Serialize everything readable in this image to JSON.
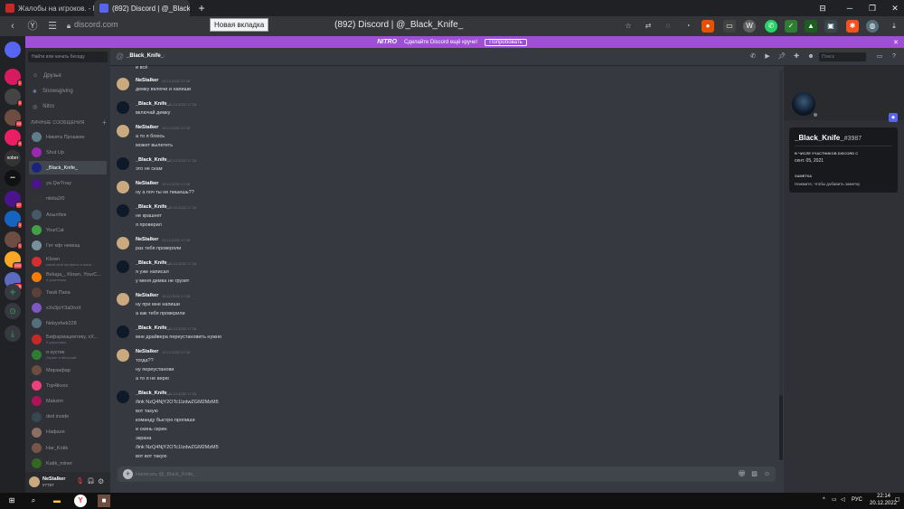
{
  "browser": {
    "tabs": [
      {
        "title": "Жалобы на игроков. - Rc",
        "active": false
      },
      {
        "title": "(892) Discord | @_Black_",
        "active": true
      }
    ],
    "tooltip": "Новая вкладка",
    "url": "discord.com",
    "page_title": "(892) Discord | @_Black_Knife_"
  },
  "nitro_banner": {
    "logo": "NITRO",
    "text": "Сделайте Discord ещё круче!",
    "button": "Попробовать"
  },
  "servers": [
    {
      "initials": "",
      "badge": "",
      "color": "#5865f2"
    },
    {
      "initials": "",
      "badge": "1",
      "color": "#d81b60"
    },
    {
      "initials": "",
      "badge": "3",
      "color": "#444"
    },
    {
      "initials": "",
      "badge": "43",
      "color": "#6d4c41"
    },
    {
      "initials": "",
      "badge": "4",
      "color": "#e91e63"
    },
    {
      "initials": "sober",
      "badge": "",
      "color": "#333"
    },
    {
      "initials": "•••",
      "badge": "",
      "color": "#111"
    },
    {
      "initials": "",
      "badge": "57",
      "color": "#4a148c"
    },
    {
      "initials": "",
      "badge": "3",
      "color": "#1565c0"
    },
    {
      "initials": "",
      "badge": "1",
      "color": "#6d4c41"
    },
    {
      "initials": "",
      "badge": "150",
      "color": "#f9a825"
    },
    {
      "initials": "",
      "badge": "248",
      "color": "#5c6bc0"
    }
  ],
  "sidebar": {
    "search_placeholder": "Найти или начать беседу",
    "nav": [
      {
        "label": "Друзья"
      },
      {
        "label": "Snowsgiving"
      },
      {
        "label": "Nitro"
      }
    ],
    "dm_header": "ЛИЧНЫЕ СООБЩЕНИЯ",
    "dms": [
      {
        "name": "Никита Прошкин",
        "sub": "",
        "color": "#607d8b"
      },
      {
        "name": "Shut Up",
        "sub": "",
        "color": "#9c27b0"
      },
      {
        "name": "_Black_Knife_",
        "sub": "",
        "color": "#1a237e",
        "selected": true
      },
      {
        "name": "ya QwTnay",
        "sub": "",
        "color": "#4a148c"
      },
      {
        "name": "nikita2/0",
        "sub": "",
        "color": "#333"
      },
      {
        "name": "Асылбек",
        "sub": "",
        "color": "#455a64"
      },
      {
        "name": "YourCat",
        "sub": "",
        "color": "#43a047"
      },
      {
        "name": "Гет кфг немощ",
        "sub": "",
        "color": "#78909c"
      },
      {
        "name": "Klown",
        "sub": "какой-мой профиль и напи...",
        "color": "#d32f2f"
      },
      {
        "name": "Beluga_, Klown, YourC...",
        "sub": "4 участника",
        "color": "#f57c00"
      },
      {
        "name": "Твой Папа",
        "sub": "",
        "color": "#5d4037"
      },
      {
        "name": "xXx3joY3aDroX",
        "sub": "",
        "color": "#7e57c2"
      },
      {
        "name": "Nebyshek228",
        "sub": "",
        "color": "#546e7a"
      },
      {
        "name": "Бифармацевтику, хХ...",
        "sub": "3 участника",
        "color": "#c62828"
      },
      {
        "name": "я кустик",
        "sub": "Играет в Minecraft",
        "color": "#2e7d32"
      },
      {
        "name": "Мирзафар",
        "sub": "",
        "color": "#6d4c41"
      },
      {
        "name": "Top4ikxxx",
        "sub": "",
        "color": "#ec407a"
      },
      {
        "name": "Maksim",
        "sub": "",
        "color": "#ad1457"
      },
      {
        "name": "ded inside",
        "sub": "",
        "color": "#37474f"
      },
      {
        "name": "Нафаня",
        "sub": "",
        "color": "#8d6e63"
      },
      {
        "name": "Har_Kotik",
        "sub": "",
        "color": "#795548"
      },
      {
        "name": "Katik_miner",
        "sub": "",
        "color": "#33691e"
      }
    ]
  },
  "user_panel": {
    "name": "NeStalker",
    "tag": "#7787"
  },
  "chat": {
    "recipient": "_Black_Knife_",
    "search_placeholder": "Поиск",
    "composer_placeholder": "Написать @_Black_Knife_",
    "top_line": "и всё",
    "messages": [
      {
        "author": "NeStalker",
        "time": "15.12.2022 17:18",
        "lines": [
          "демку включи и напиши"
        ],
        "color": "#c9a97d"
      },
      {
        "author": "_Black_Knife_",
        "time": "15.12.2022 17:18",
        "lines": [
          "включай демку"
        ],
        "color": "#0e1a2a"
      },
      {
        "author": "NeStalker",
        "time": "15.12.2022 17:18",
        "lines": [
          "а то я боюсь",
          "может вылететь"
        ],
        "color": "#c9a97d"
      },
      {
        "author": "_Black_Knife_",
        "time": "15.12.2022 17:18",
        "lines": [
          "это не скам"
        ],
        "color": "#0e1a2a"
      },
      {
        "author": "NeStalker",
        "time": "15.12.2022 17:18",
        "lines": [
          "ну а поч ты не пишешь??"
        ],
        "color": "#c9a97d"
      },
      {
        "author": "_Black_Knife_",
        "time": "15.12.2022 17:18",
        "lines": [
          "не крашнет",
          "я проверил"
        ],
        "color": "#0e1a2a"
      },
      {
        "author": "NeStalker",
        "time": "15.12.2022 17:18",
        "lines": [
          "раз тебя проверяли"
        ],
        "color": "#c9a97d"
      },
      {
        "author": "_Black_Knife_",
        "time": "15.12.2022 17:18",
        "lines": [
          "я уже написал",
          "у меня демка не грузит"
        ],
        "color": "#0e1a2a"
      },
      {
        "author": "NeStalker",
        "time": "15.12.2022 17:18",
        "lines": [
          "ну при мне напиши",
          "а как тебя проверили"
        ],
        "color": "#c9a97d"
      },
      {
        "author": "_Black_Knife_",
        "time": "15.12.2022 17:18",
        "lines": [
          "мне драйвера переустановить нужно"
        ],
        "color": "#0e1a2a"
      },
      {
        "author": "NeStalker",
        "time": "15.12.2022 17:18",
        "lines": [
          "тогда??",
          "ну переустанови",
          "а то я не верю"
        ],
        "color": "#c9a97d"
      },
      {
        "author": "_Black_Knife_",
        "time": "15.12.2022 17:18",
        "lines": [
          "/link NzQ4NjY2OTc1IzdwZGM2MzM5",
          "вот такую",
          "команду быстро пропиши",
          "и скинь скрин",
          "экрана",
          "/link NzQ4NjY2OTc1IzdwZGM2MzM5",
          "вот вот такую"
        ],
        "color": "#0e1a2a"
      }
    ]
  },
  "profile": {
    "name": "_Black_Knife_",
    "discriminator": "#3987",
    "member_since_label": "В ЧИСЛЕ УЧАСТНИКОВ DISCORD С",
    "member_since": "сент. 05, 2021",
    "note_label": "ЗАМЕТКА",
    "note_placeholder": "Нажмите, чтобы добавить заметку"
  },
  "taskbar": {
    "lang": "РУС",
    "time": "22:14",
    "date": "20.12.2022"
  }
}
